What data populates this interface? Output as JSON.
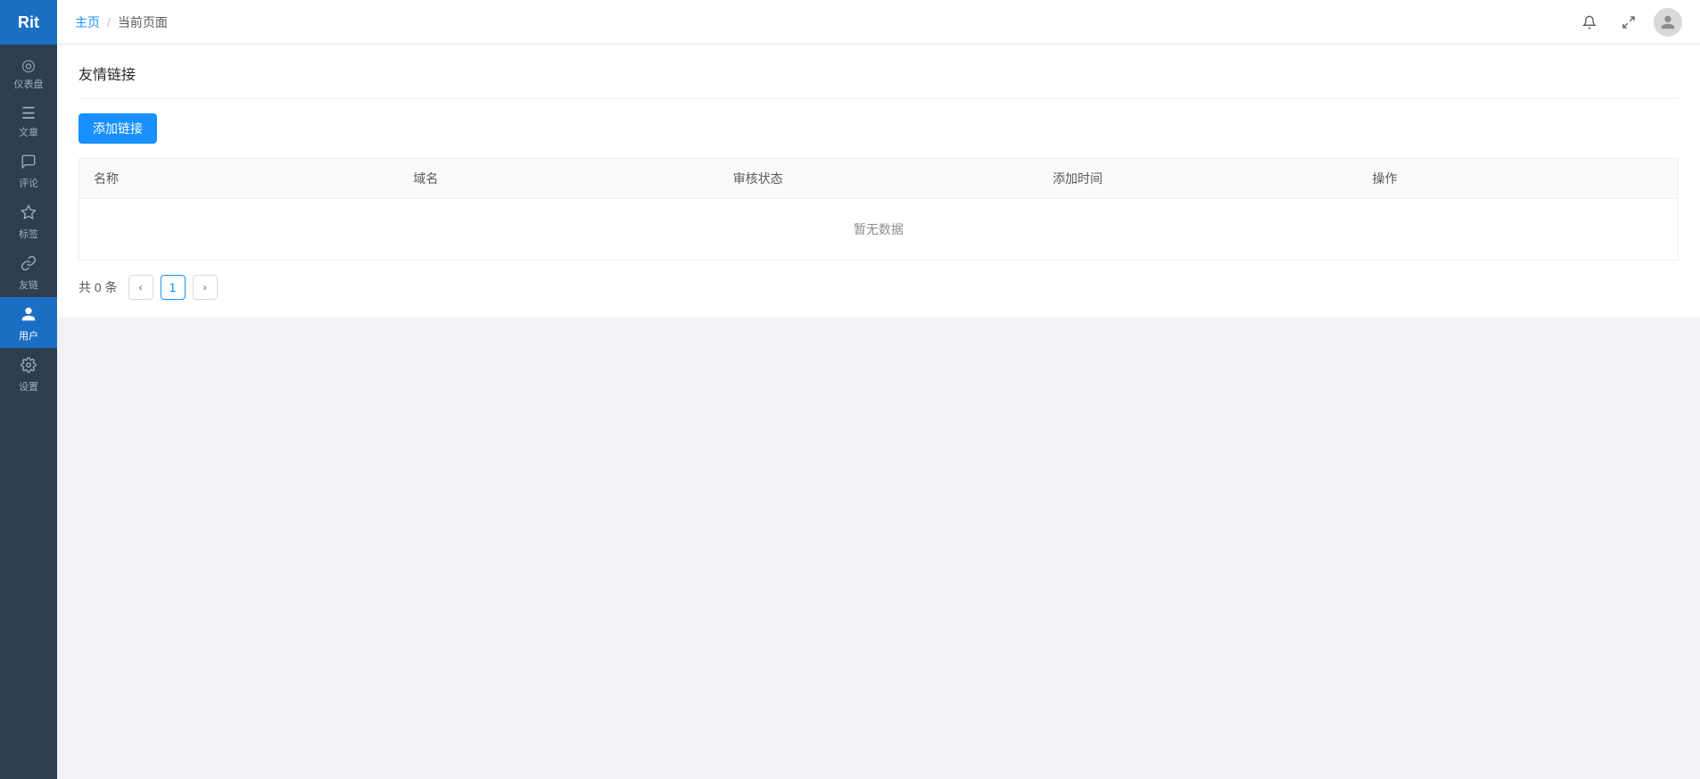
{
  "sidebar": {
    "logo_text": "Rit",
    "items": [
      {
        "id": "dashboard",
        "label": "仪表盘",
        "icon": "◎",
        "active": false
      },
      {
        "id": "articles",
        "label": "文章",
        "icon": "≡",
        "active": false
      },
      {
        "id": "comments",
        "label": "评论",
        "icon": "💬",
        "icon_unicode": "◻",
        "active": false
      },
      {
        "id": "tags",
        "label": "标签",
        "icon": "🏷",
        "icon_unicode": "⬡",
        "active": false
      },
      {
        "id": "friends",
        "label": "友链",
        "icon": "∞",
        "active": false
      },
      {
        "id": "users",
        "label": "用户",
        "icon": "👤",
        "icon_unicode": "⊙",
        "active": true
      },
      {
        "id": "settings",
        "label": "设置",
        "icon": "⚙",
        "active": false
      }
    ]
  },
  "header": {
    "breadcrumb_home": "主页",
    "breadcrumb_current": "当前页面",
    "separator": "/"
  },
  "page": {
    "title": "友情链接",
    "add_button_label": "添加链接"
  },
  "table": {
    "columns": [
      {
        "key": "name",
        "label": "名称"
      },
      {
        "key": "domain",
        "label": "域名"
      },
      {
        "key": "status",
        "label": "审核状态"
      },
      {
        "key": "created_at",
        "label": "添加时间"
      },
      {
        "key": "actions",
        "label": "操作"
      }
    ],
    "empty_text": "暂无数据",
    "rows": []
  },
  "pagination": {
    "total_text": "共 0 条",
    "current_page": 1,
    "prev_icon": "‹",
    "next_icon": "›"
  }
}
